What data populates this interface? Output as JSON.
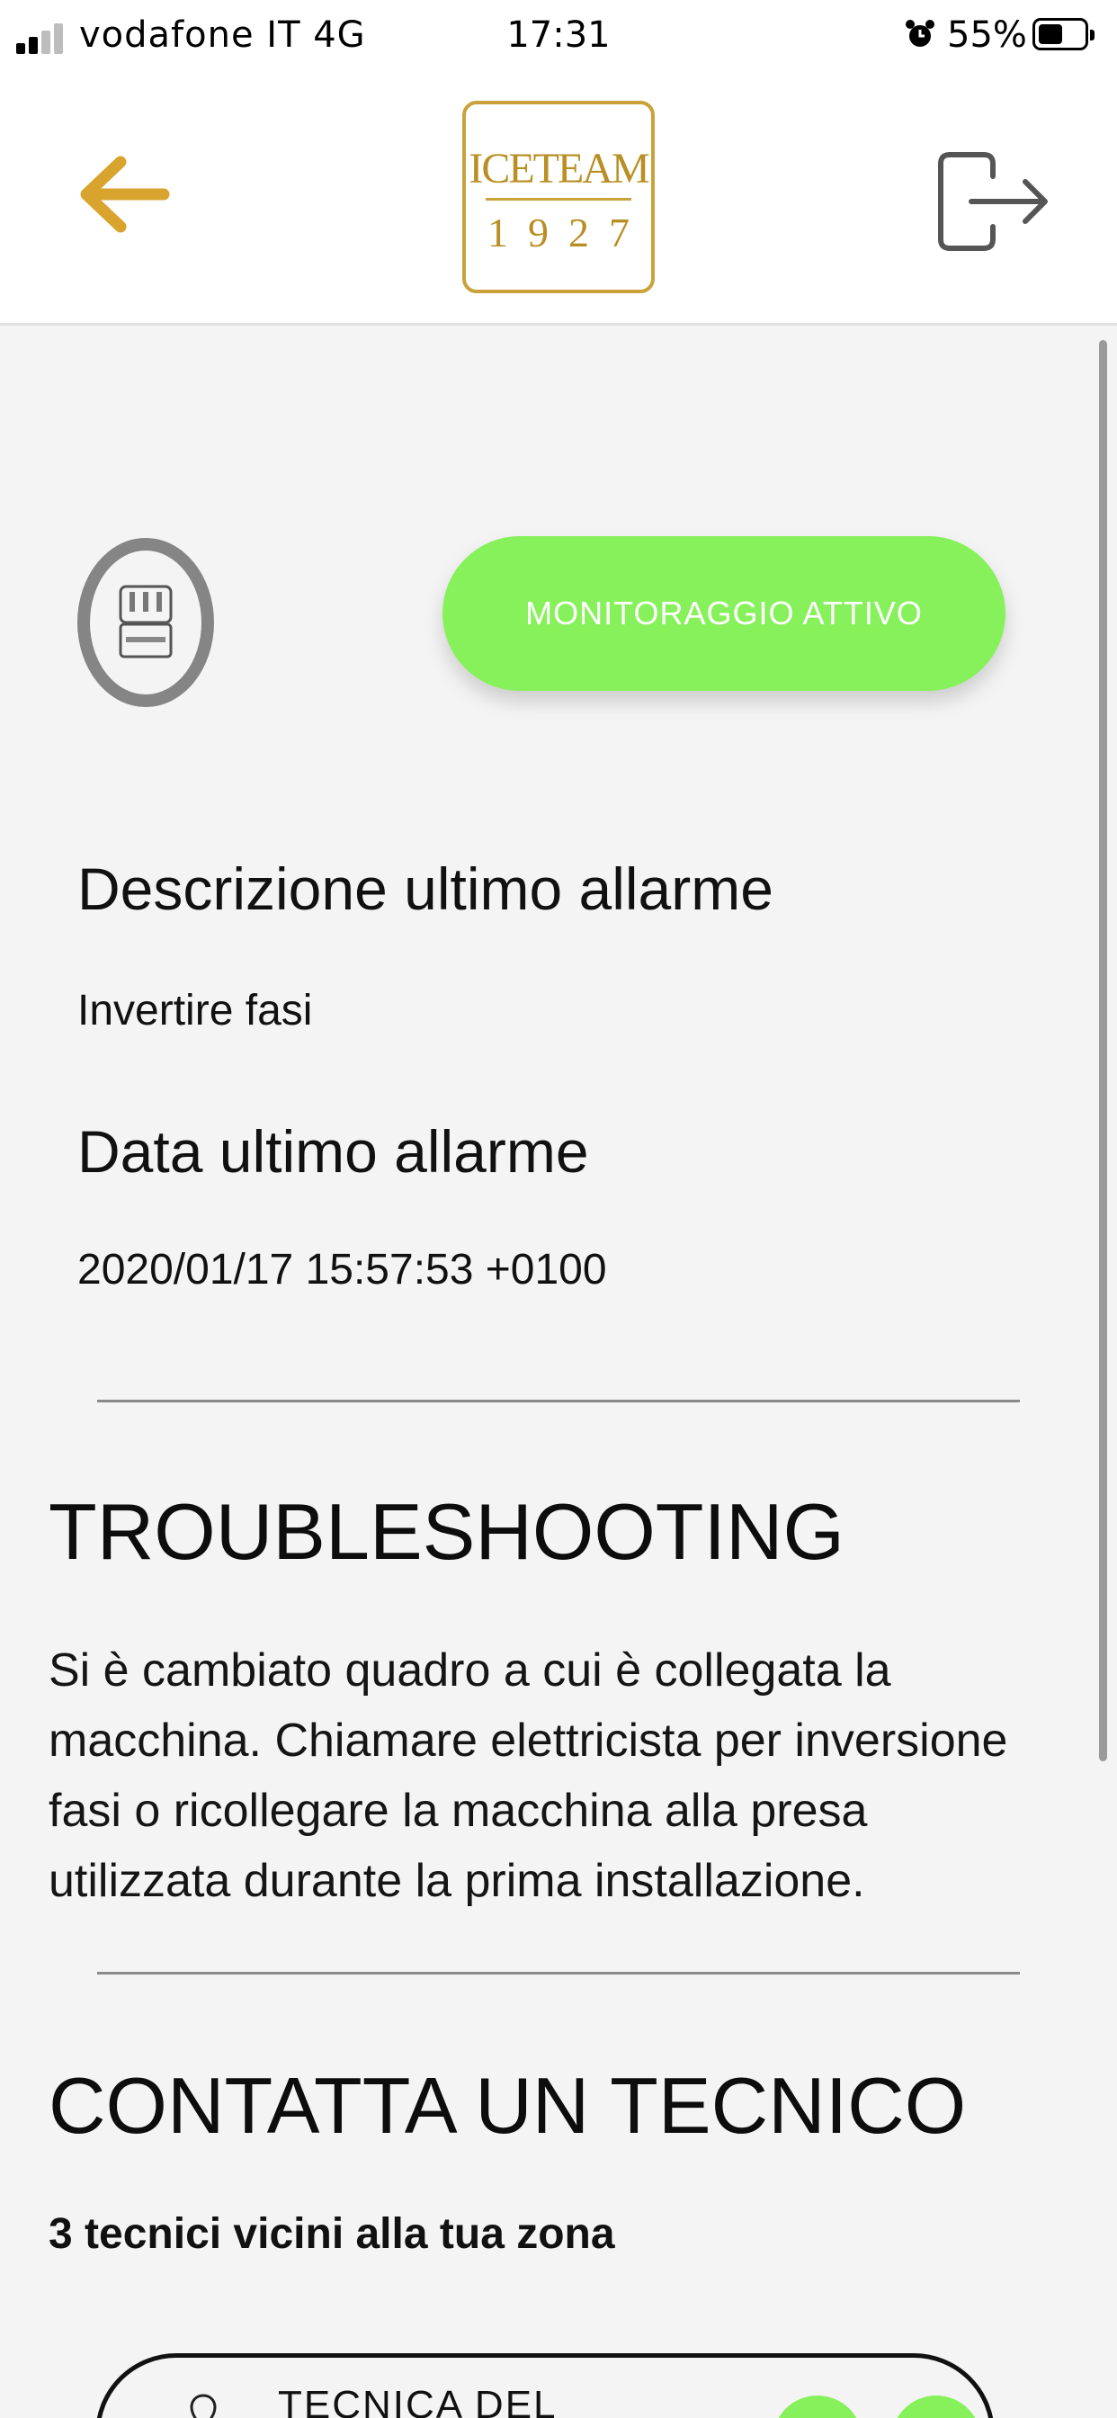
{
  "status_bar": {
    "carrier": "vodafone IT  4G",
    "time": "17:31",
    "battery": "55%"
  },
  "header": {
    "logo_brand": "ICETEAM",
    "logo_year": "1927",
    "back_icon": "arrow-left-icon",
    "logout_icon": "logout-icon"
  },
  "device": {
    "icon": "ice-cream-machine-icon",
    "monitoring_label": "MONITORAGGIO  ATTIVO"
  },
  "alarm": {
    "description_title": "Descrizione ultimo allarme",
    "description_value": "Invertire fasi",
    "date_title": "Data ultimo allarme",
    "date_value": "2020/01/17 15:57:53 +0100"
  },
  "troubleshooting": {
    "title": "TROUBLESHOOTING",
    "text": "Si è cambiato quadro a cui è collegata la macchina. Chiamare elettricista per inversione fasi o ricollegare la macchina alla presa utilizzata durante la prima installazione."
  },
  "contact": {
    "title": "CONTATTA UN TECNICO",
    "subtitle": "3 tecnici vicini alla tua zona",
    "technicians": [
      {
        "name": "TECNICA DEL"
      }
    ]
  },
  "colors": {
    "accent_gold": "#c9a23a",
    "monitor_green": "#86f15a",
    "background": "#f4f4f4"
  }
}
